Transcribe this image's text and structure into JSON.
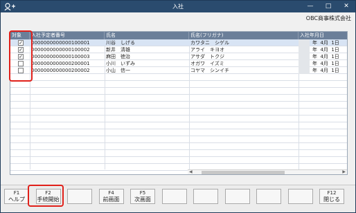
{
  "titlebar": {
    "title": "入社",
    "icon": "person-add-icon"
  },
  "window_controls": {
    "minimize": "—",
    "maximize": "□",
    "close": "✕"
  },
  "company": "OBC商事株式会社",
  "table": {
    "columns": [
      "対象",
      "入社予定者番号",
      "氏名",
      "氏名(フリガナ)",
      "入社年月日"
    ],
    "rows": [
      {
        "checked": true,
        "check_mark": "✓",
        "number": "0000000000000100001",
        "name": "川谷　しげる",
        "kana": "カワタニ　シゲル",
        "date": "年  4月  1日"
      },
      {
        "checked": true,
        "check_mark": "✓",
        "number": "0000000000000100002",
        "name": "新井　清雄",
        "kana": "アライ　キヨオ",
        "date": "年  4月  1日"
      },
      {
        "checked": true,
        "check_mark": "✓",
        "number": "0000000000000100003",
        "name": "麻田　徳治",
        "kana": "アサダ　トクジ",
        "date": "年  4月  1日"
      },
      {
        "checked": false,
        "check_mark": "",
        "number": "0000000000000200001",
        "name": "小川　いずみ",
        "kana": "オガワ　イズミ",
        "date": "年  4月  1日"
      },
      {
        "checked": false,
        "check_mark": "",
        "number": "0000000000000200002",
        "name": "小山　信一",
        "kana": "コヤマ　シンイチ",
        "date": "年  4月  1日"
      }
    ]
  },
  "fkeys": [
    {
      "key": "F1",
      "label": "ヘルプ"
    },
    {
      "key": "F2",
      "label": "手続開始"
    },
    {
      "key": "",
      "label": ""
    },
    {
      "key": "F4",
      "label": "前画面"
    },
    {
      "key": "F5",
      "label": "次画面"
    },
    {
      "key": "",
      "label": ""
    },
    {
      "key": "",
      "label": ""
    },
    {
      "key": "",
      "label": ""
    },
    {
      "key": "",
      "label": ""
    },
    {
      "key": "",
      "label": ""
    },
    {
      "key": "F12",
      "label": "閉じる"
    }
  ],
  "colors": {
    "titlebar": "#2a4b6e",
    "header": "#6b7f99",
    "highlight": "#e0201a"
  }
}
